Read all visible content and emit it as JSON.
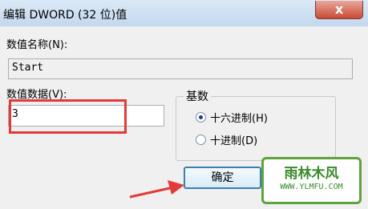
{
  "window": {
    "title": "编辑 DWORD (32 位)值",
    "close_glyph": "x"
  },
  "name_field": {
    "label": "数值名称(N):",
    "value": "Start"
  },
  "data_field": {
    "label": "数值数据(V):",
    "value": "3"
  },
  "base_group": {
    "title": "基数",
    "options": [
      {
        "label": "十六进制(H)",
        "selected": true
      },
      {
        "label": "十进制(D)",
        "selected": false
      }
    ]
  },
  "buttons": {
    "ok": "确定"
  },
  "watermark": {
    "name": "雨林木风",
    "url": "WWW.YLMFU.COM"
  },
  "colors": {
    "highlight": "#e33a3a",
    "titlebar": "#c3d8ee",
    "accent_button_border": "#3c7fb1",
    "watermark": "#5fa33b"
  }
}
